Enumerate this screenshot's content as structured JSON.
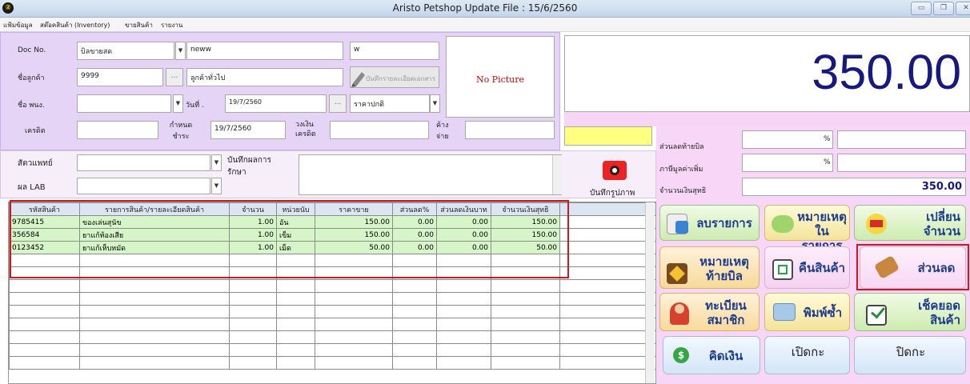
{
  "window": {
    "title": "Aristo Petshop  Update File : 15/6/2560",
    "icon_glyph": "②"
  },
  "menu": [
    "แฟ้มข้อมูล",
    "สต๊อคสินค้า (Inventory)",
    "ขายสินค้า",
    "รายงาน"
  ],
  "header": {
    "doc_no_label": "Doc No.",
    "doc_type": "บิลขายสด",
    "doc_name": "neww",
    "doc_extra": "w",
    "customer_label": "ชื่อลูกค้า",
    "customer_code": "9999",
    "customer_name": "ลูกค้าทั่วไป",
    "save_detail": "บันทึกรายละเอียดเอกสาร",
    "no_picture": "No Picture",
    "staff_label": "ชื่อ พนง.",
    "staff_value": "",
    "date_label": "วันที่ .",
    "date_value": "19/7/2560",
    "price_type": "ราคาปกติ",
    "credit_label": "เครดิต",
    "credit_value": "",
    "due_label": "กำหนด ชำระ",
    "due_value": "19/7/2560",
    "credit_limit_label": "วงเงิน เครดิต",
    "credit_limit_value": "",
    "owe_label": "ค้าง จ่าย",
    "owe_value": ""
  },
  "mid": {
    "vet_label": "สัตวแพทย์",
    "lab_label": "ผล LAB",
    "treatment_label": "บันทึกผลการ รักษา",
    "photo_label": "บันทึกรูปภาพ"
  },
  "total": {
    "amount": "350.00"
  },
  "summary": {
    "discount_label": "ส่วนลดท้ายบิล",
    "vat_label": "ภาษีมูลค่าเพิ่ม",
    "percent": "%",
    "net_label": "จำนวนเงินสุทธิ",
    "net_value": "350.00"
  },
  "grid": {
    "columns": [
      "รหัสสินค้า",
      "รายการสินค้า/รายละเอียดสินค้า",
      "จำนวน",
      "หน่วยนับ",
      "ราคาขาย",
      "ส่วนลด%",
      "ส่วนลดเงินบาท",
      "จำนวนเงินสุทธิ"
    ],
    "rows": [
      {
        "code": "9785415",
        "name": "ของเล่นสุนัข",
        "qty": "1.00",
        "unit": "อัน",
        "price": "150.00",
        "disc_pct": "0.00",
        "disc_baht": "0.00",
        "net": "150.00"
      },
      {
        "code": "356584",
        "name": "ยาแก้ท้องเสีย",
        "qty": "1.00",
        "unit": "เข็ม",
        "price": "150.00",
        "disc_pct": "0.00",
        "disc_baht": "0.00",
        "net": "150.00"
      },
      {
        "code": "0123452",
        "name": "ยาแก้เห็บหมัด",
        "qty": "1.00",
        "unit": "เม็ด",
        "price": "50.00",
        "disc_pct": "0.00",
        "disc_baht": "0.00",
        "net": "50.00"
      }
    ]
  },
  "buttons": {
    "delete": "ลบรายการ",
    "item_note_1": "หมายเหตุ",
    "item_note_2": "ในรายการ",
    "change_qty_1": "เปลี่ยน",
    "change_qty_2": "จำนวน",
    "bill_note_1": "หมายเหตุ",
    "bill_note_2": "ท้ายบิล",
    "return": "คืนสินค้า",
    "discount": "ส่วนลด",
    "member_1": "ทะเบียน",
    "member_2": "สมาชิก",
    "reprint": "พิมพ์ซ้ำ",
    "check_stock_1": "เช็คยอด",
    "check_stock_2": "สินค้า",
    "pay": "คิดเงิน",
    "open_drawer": "เปิดกะ",
    "close_drawer": "ปิดกะ"
  },
  "colors": {
    "total_text": "#16197e",
    "highlight_red": "#d2161e",
    "row_green": "#d6f5c8",
    "panel_purple": "#e6d4f7",
    "panel_pink": "#f7d6f7"
  }
}
